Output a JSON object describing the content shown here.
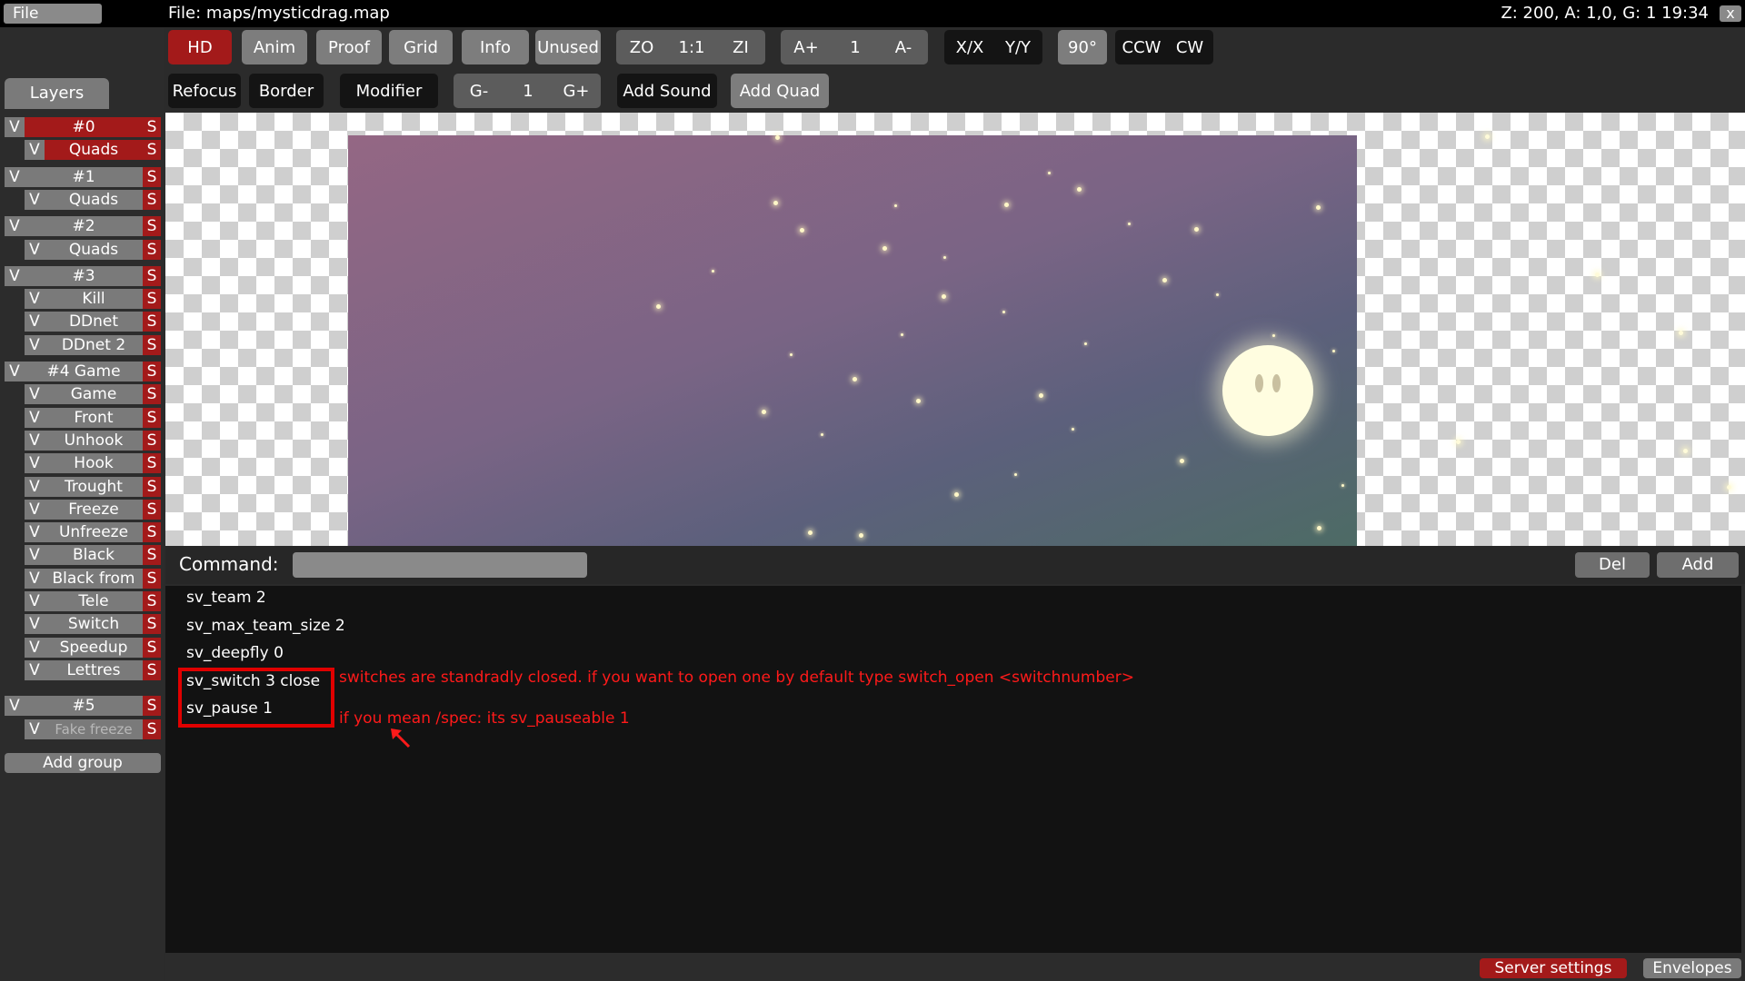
{
  "topbar": {
    "file_menu": "File",
    "file_label": "File: maps/mysticdrag.map",
    "status": "Z: 200, A: 1,0, G: 1  19:34",
    "close": "x"
  },
  "toolbar": {
    "row1": {
      "hd": "HD",
      "anim": "Anim",
      "proof": "Proof",
      "grid": "Grid",
      "info": "Info",
      "unused": "Unused",
      "zoom_out": "ZO",
      "zoom_reset": "1:1",
      "zoom_in": "ZI",
      "anim_faster": "A+",
      "anim_speed": "1",
      "anim_slower": "A-",
      "flip_x": "X/X",
      "flip_y": "Y/Y",
      "rotate_90": "90°",
      "ccw": "CCW",
      "cw": "CW"
    },
    "row2": {
      "refocus": "Refocus",
      "border": "Border",
      "modifier": "Modifier",
      "grid_minus": "G-",
      "grid_factor": "1",
      "grid_plus": "G+",
      "add_sound": "Add Sound",
      "add_quad": "Add Quad"
    }
  },
  "layers_panel": {
    "tab": "Layers",
    "visible_toggle": "V",
    "solo_toggle": "S",
    "groups": [
      {
        "name": "#0",
        "active": true,
        "layers": [
          {
            "name": "Quads",
            "active": true
          }
        ]
      },
      {
        "name": "#1",
        "layers": [
          {
            "name": "Quads"
          }
        ]
      },
      {
        "name": "#2",
        "layers": [
          {
            "name": "Quads"
          }
        ]
      },
      {
        "name": "#3",
        "layers": [
          {
            "name": "Kill"
          },
          {
            "name": "DDnet"
          },
          {
            "name": "DDnet 2"
          }
        ]
      },
      {
        "name": "#4 Game",
        "layers": [
          {
            "name": "Game"
          },
          {
            "name": "Front"
          },
          {
            "name": "Unhook"
          },
          {
            "name": "Hook"
          },
          {
            "name": "Trought"
          },
          {
            "name": "Freeze"
          },
          {
            "name": "Unfreeze"
          },
          {
            "name": "Black"
          },
          {
            "name": "Black from"
          },
          {
            "name": "Tele"
          },
          {
            "name": "Switch"
          },
          {
            "name": "Speedup"
          },
          {
            "name": "Lettres"
          }
        ]
      },
      {
        "name": "#5",
        "layers": [
          {
            "name": "Fake freeze",
            "faded": true
          }
        ]
      }
    ],
    "add_group": "Add group"
  },
  "command": {
    "label": "Command:",
    "input_value": "",
    "del": "Del",
    "add": "Add",
    "items": [
      "sv_team 2",
      "sv_max_team_size 2",
      "sv_deepfly 0",
      "sv_switch 3 close",
      "sv_pause 1"
    ]
  },
  "annotations": {
    "note1": "switches are standradly closed. if you want to open one by default type switch_open <switchnumber>",
    "note2": "if you mean /spec: its sv_pauseable 1",
    "color": "#ff1a1a"
  },
  "bottom_bar": {
    "server_settings": "Server settings",
    "envelopes": "Envelopes"
  },
  "colors": {
    "accent_red": "#a31a1a",
    "button_grey": "#7d7d7d"
  }
}
